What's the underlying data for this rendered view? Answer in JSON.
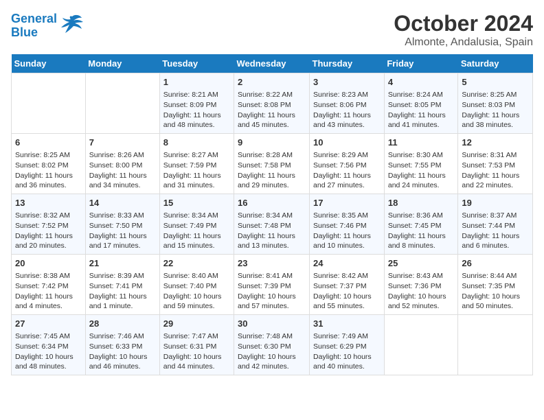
{
  "logo": {
    "general": "General",
    "blue": "Blue"
  },
  "title": "October 2024",
  "subtitle": "Almonte, Andalusia, Spain",
  "headers": [
    "Sunday",
    "Monday",
    "Tuesday",
    "Wednesday",
    "Thursday",
    "Friday",
    "Saturday"
  ],
  "weeks": [
    [
      {
        "day": "",
        "sunrise": "",
        "sunset": "",
        "daylight": ""
      },
      {
        "day": "",
        "sunrise": "",
        "sunset": "",
        "daylight": ""
      },
      {
        "day": "1",
        "sunrise": "Sunrise: 8:21 AM",
        "sunset": "Sunset: 8:09 PM",
        "daylight": "Daylight: 11 hours and 48 minutes."
      },
      {
        "day": "2",
        "sunrise": "Sunrise: 8:22 AM",
        "sunset": "Sunset: 8:08 PM",
        "daylight": "Daylight: 11 hours and 45 minutes."
      },
      {
        "day": "3",
        "sunrise": "Sunrise: 8:23 AM",
        "sunset": "Sunset: 8:06 PM",
        "daylight": "Daylight: 11 hours and 43 minutes."
      },
      {
        "day": "4",
        "sunrise": "Sunrise: 8:24 AM",
        "sunset": "Sunset: 8:05 PM",
        "daylight": "Daylight: 11 hours and 41 minutes."
      },
      {
        "day": "5",
        "sunrise": "Sunrise: 8:25 AM",
        "sunset": "Sunset: 8:03 PM",
        "daylight": "Daylight: 11 hours and 38 minutes."
      }
    ],
    [
      {
        "day": "6",
        "sunrise": "Sunrise: 8:25 AM",
        "sunset": "Sunset: 8:02 PM",
        "daylight": "Daylight: 11 hours and 36 minutes."
      },
      {
        "day": "7",
        "sunrise": "Sunrise: 8:26 AM",
        "sunset": "Sunset: 8:00 PM",
        "daylight": "Daylight: 11 hours and 34 minutes."
      },
      {
        "day": "8",
        "sunrise": "Sunrise: 8:27 AM",
        "sunset": "Sunset: 7:59 PM",
        "daylight": "Daylight: 11 hours and 31 minutes."
      },
      {
        "day": "9",
        "sunrise": "Sunrise: 8:28 AM",
        "sunset": "Sunset: 7:58 PM",
        "daylight": "Daylight: 11 hours and 29 minutes."
      },
      {
        "day": "10",
        "sunrise": "Sunrise: 8:29 AM",
        "sunset": "Sunset: 7:56 PM",
        "daylight": "Daylight: 11 hours and 27 minutes."
      },
      {
        "day": "11",
        "sunrise": "Sunrise: 8:30 AM",
        "sunset": "Sunset: 7:55 PM",
        "daylight": "Daylight: 11 hours and 24 minutes."
      },
      {
        "day": "12",
        "sunrise": "Sunrise: 8:31 AM",
        "sunset": "Sunset: 7:53 PM",
        "daylight": "Daylight: 11 hours and 22 minutes."
      }
    ],
    [
      {
        "day": "13",
        "sunrise": "Sunrise: 8:32 AM",
        "sunset": "Sunset: 7:52 PM",
        "daylight": "Daylight: 11 hours and 20 minutes."
      },
      {
        "day": "14",
        "sunrise": "Sunrise: 8:33 AM",
        "sunset": "Sunset: 7:50 PM",
        "daylight": "Daylight: 11 hours and 17 minutes."
      },
      {
        "day": "15",
        "sunrise": "Sunrise: 8:34 AM",
        "sunset": "Sunset: 7:49 PM",
        "daylight": "Daylight: 11 hours and 15 minutes."
      },
      {
        "day": "16",
        "sunrise": "Sunrise: 8:34 AM",
        "sunset": "Sunset: 7:48 PM",
        "daylight": "Daylight: 11 hours and 13 minutes."
      },
      {
        "day": "17",
        "sunrise": "Sunrise: 8:35 AM",
        "sunset": "Sunset: 7:46 PM",
        "daylight": "Daylight: 11 hours and 10 minutes."
      },
      {
        "day": "18",
        "sunrise": "Sunrise: 8:36 AM",
        "sunset": "Sunset: 7:45 PM",
        "daylight": "Daylight: 11 hours and 8 minutes."
      },
      {
        "day": "19",
        "sunrise": "Sunrise: 8:37 AM",
        "sunset": "Sunset: 7:44 PM",
        "daylight": "Daylight: 11 hours and 6 minutes."
      }
    ],
    [
      {
        "day": "20",
        "sunrise": "Sunrise: 8:38 AM",
        "sunset": "Sunset: 7:42 PM",
        "daylight": "Daylight: 11 hours and 4 minutes."
      },
      {
        "day": "21",
        "sunrise": "Sunrise: 8:39 AM",
        "sunset": "Sunset: 7:41 PM",
        "daylight": "Daylight: 11 hours and 1 minute."
      },
      {
        "day": "22",
        "sunrise": "Sunrise: 8:40 AM",
        "sunset": "Sunset: 7:40 PM",
        "daylight": "Daylight: 10 hours and 59 minutes."
      },
      {
        "day": "23",
        "sunrise": "Sunrise: 8:41 AM",
        "sunset": "Sunset: 7:39 PM",
        "daylight": "Daylight: 10 hours and 57 minutes."
      },
      {
        "day": "24",
        "sunrise": "Sunrise: 8:42 AM",
        "sunset": "Sunset: 7:37 PM",
        "daylight": "Daylight: 10 hours and 55 minutes."
      },
      {
        "day": "25",
        "sunrise": "Sunrise: 8:43 AM",
        "sunset": "Sunset: 7:36 PM",
        "daylight": "Daylight: 10 hours and 52 minutes."
      },
      {
        "day": "26",
        "sunrise": "Sunrise: 8:44 AM",
        "sunset": "Sunset: 7:35 PM",
        "daylight": "Daylight: 10 hours and 50 minutes."
      }
    ],
    [
      {
        "day": "27",
        "sunrise": "Sunrise: 7:45 AM",
        "sunset": "Sunset: 6:34 PM",
        "daylight": "Daylight: 10 hours and 48 minutes."
      },
      {
        "day": "28",
        "sunrise": "Sunrise: 7:46 AM",
        "sunset": "Sunset: 6:33 PM",
        "daylight": "Daylight: 10 hours and 46 minutes."
      },
      {
        "day": "29",
        "sunrise": "Sunrise: 7:47 AM",
        "sunset": "Sunset: 6:31 PM",
        "daylight": "Daylight: 10 hours and 44 minutes."
      },
      {
        "day": "30",
        "sunrise": "Sunrise: 7:48 AM",
        "sunset": "Sunset: 6:30 PM",
        "daylight": "Daylight: 10 hours and 42 minutes."
      },
      {
        "day": "31",
        "sunrise": "Sunrise: 7:49 AM",
        "sunset": "Sunset: 6:29 PM",
        "daylight": "Daylight: 10 hours and 40 minutes."
      },
      {
        "day": "",
        "sunrise": "",
        "sunset": "",
        "daylight": ""
      },
      {
        "day": "",
        "sunrise": "",
        "sunset": "",
        "daylight": ""
      }
    ]
  ]
}
